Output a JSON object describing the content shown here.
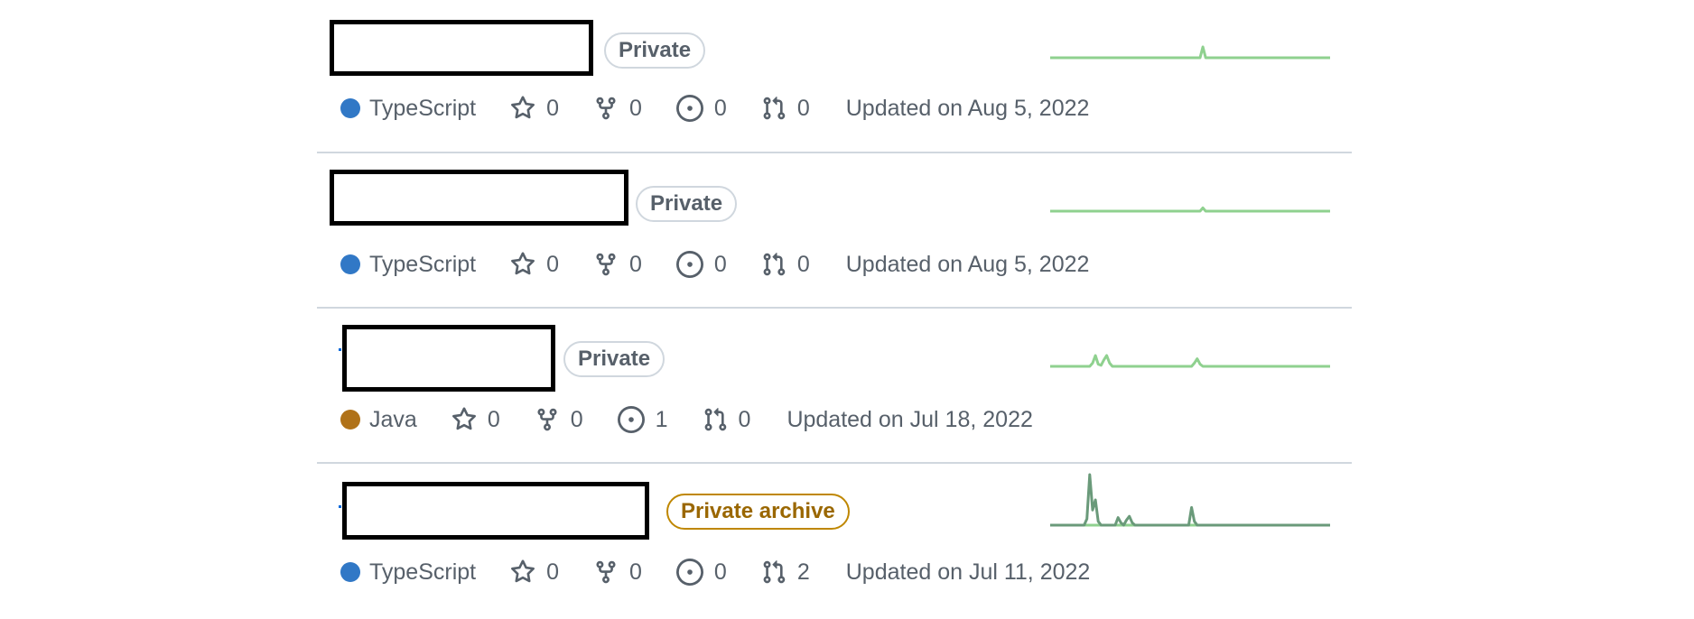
{
  "repos": [
    {
      "visibility": "Private",
      "language": "TypeScript",
      "language_color": "#3178c6",
      "stars": "0",
      "forks": "0",
      "issues": "0",
      "pulls": "0",
      "updated": "Updated on Aug 5, 2022",
      "activity": [
        0,
        0,
        0,
        0,
        0,
        0,
        0,
        0,
        0,
        0,
        0,
        0,
        0,
        0,
        0,
        0,
        0,
        0,
        0,
        0,
        0,
        0,
        0,
        0,
        0,
        0,
        0,
        0,
        0,
        0,
        0,
        0,
        0,
        0,
        0,
        0,
        0,
        0,
        0,
        0,
        0,
        0,
        0,
        0,
        0,
        0,
        0,
        0,
        0,
        0,
        0,
        0,
        0,
        0,
        1,
        0,
        0,
        0,
        0,
        0,
        0,
        0,
        0,
        0,
        0,
        0,
        0,
        0,
        0,
        0,
        0,
        0,
        0,
        0,
        0,
        0,
        0,
        0,
        0,
        0,
        0,
        0,
        0,
        0,
        0,
        0,
        0,
        0,
        0,
        0,
        0,
        0,
        0,
        0,
        0,
        0,
        0,
        0,
        0,
        0
      ]
    },
    {
      "visibility": "Private",
      "language": "TypeScript",
      "language_color": "#3178c6",
      "stars": "0",
      "forks": "0",
      "issues": "0",
      "pulls": "0",
      "updated": "Updated on Aug 5, 2022",
      "activity": [
        0,
        0,
        0,
        0,
        0,
        0,
        0,
        0,
        0,
        0,
        0,
        0,
        0,
        0,
        0,
        0,
        0,
        0,
        0,
        0,
        0,
        0,
        0,
        0,
        0,
        0,
        0,
        0,
        0,
        0,
        0,
        0,
        0,
        0,
        0,
        0,
        0,
        0,
        0,
        0,
        0,
        0,
        0,
        0,
        0,
        0,
        0,
        0,
        0,
        0,
        0,
        0,
        0,
        0,
        0.3,
        0,
        0,
        0,
        0,
        0,
        0,
        0,
        0,
        0,
        0,
        0,
        0,
        0,
        0,
        0,
        0,
        0,
        0,
        0,
        0,
        0,
        0,
        0,
        0,
        0,
        0,
        0,
        0,
        0,
        0,
        0,
        0,
        0,
        0,
        0,
        0,
        0,
        0,
        0,
        0,
        0,
        0,
        0,
        0,
        0
      ]
    },
    {
      "visibility": "Private",
      "language": "Java",
      "language_color": "#b07219",
      "stars": "0",
      "forks": "0",
      "issues": "1",
      "pulls": "0",
      "updated": "Updated on Jul 18, 2022",
      "activity": [
        0,
        0,
        0,
        0,
        0,
        0,
        0,
        0,
        0,
        0,
        0,
        0,
        0,
        0,
        0,
        0.3,
        1,
        0.2,
        0.1,
        0.6,
        1,
        0.3,
        0,
        0,
        0,
        0,
        0,
        0,
        0,
        0,
        0,
        0,
        0,
        0,
        0,
        0,
        0,
        0,
        0,
        0,
        0,
        0,
        0,
        0,
        0,
        0,
        0,
        0,
        0,
        0,
        0,
        0.3,
        0.7,
        0.2,
        0,
        0,
        0,
        0,
        0,
        0,
        0,
        0,
        0,
        0,
        0,
        0,
        0,
        0,
        0,
        0,
        0,
        0,
        0,
        0,
        0,
        0,
        0,
        0,
        0,
        0,
        0,
        0,
        0,
        0,
        0,
        0,
        0,
        0,
        0,
        0,
        0,
        0,
        0,
        0,
        0,
        0,
        0,
        0,
        0,
        0
      ]
    },
    {
      "visibility": "Private archive",
      "language": "TypeScript",
      "language_color": "#3178c6",
      "stars": "0",
      "forks": "0",
      "issues": "0",
      "pulls": "2",
      "updated": "Updated on Jul 11, 2022",
      "activity": [
        0,
        0,
        0,
        0,
        0,
        0,
        0,
        0,
        0,
        0,
        0,
        0,
        0,
        0.5,
        4,
        1.2,
        2,
        0.3,
        0,
        0,
        0,
        0,
        0,
        0,
        0.6,
        0.2,
        0,
        0.4,
        0.7,
        0.2,
        0,
        0,
        0,
        0,
        0,
        0,
        0,
        0,
        0,
        0,
        0,
        0,
        0,
        0,
        0,
        0,
        0,
        0,
        0,
        0,
        1.4,
        0.3,
        0,
        0,
        0,
        0,
        0,
        0,
        0,
        0,
        0,
        0,
        0,
        0,
        0,
        0,
        0,
        0,
        0,
        0,
        0,
        0,
        0,
        0,
        0,
        0,
        0,
        0,
        0,
        0,
        0,
        0,
        0,
        0,
        0,
        0,
        0,
        0,
        0,
        0,
        0,
        0,
        0,
        0,
        0,
        0,
        0,
        0,
        0,
        0
      ]
    }
  ],
  "colors": {
    "spark_line": "#8fd18f",
    "spark_peak": "#6a9a7a",
    "badge_border": "#d0d7de",
    "archive_border": "#bf8700",
    "archive_text": "#9a6700"
  },
  "icons": {
    "star": "star-icon",
    "fork": "repo-forked-icon",
    "issue": "issue-opened-icon",
    "pull": "git-pull-request-icon"
  }
}
